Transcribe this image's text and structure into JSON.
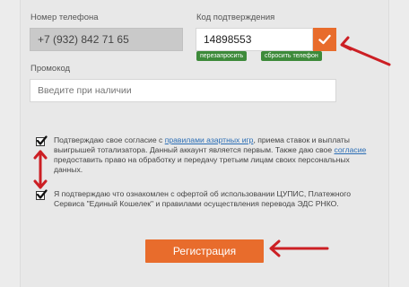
{
  "phone": {
    "label": "Номер телефона",
    "value": "+7 (932) 842 71 65"
  },
  "code": {
    "label": "Код подтверждения",
    "value": "14898553",
    "resend_label": "перезапросить",
    "reset_label": "сбросить телефон",
    "confirm_icon": "check-icon"
  },
  "promo": {
    "label": "Промокод",
    "placeholder": "Введите при наличии"
  },
  "consent1": {
    "text_before": "Подтверждаю свое согласие с ",
    "link1": "правилами азартных игр",
    "text_mid": ", приема ставок и выплаты выигрышей тотализатора. Данный аккаунт является первым. Также даю свое ",
    "link2": "согласие",
    "text_after": " предоставить право на обработку и передачу третьим лицам своих персональных данных.",
    "checked": true
  },
  "consent2": {
    "text": "Я подтверждаю что ознакомлен с офертой об использовании ЦУПИС, Платежного Сервиса \"Единый Кошелек\" и правилами осуществления перевода ЭДС РНКО.",
    "checked": true
  },
  "register_label": "Регистрация",
  "colors": {
    "accent": "#e86c2c",
    "chip": "#3d8a3a",
    "annotation": "#cc1f24",
    "link": "#2a6db5"
  }
}
